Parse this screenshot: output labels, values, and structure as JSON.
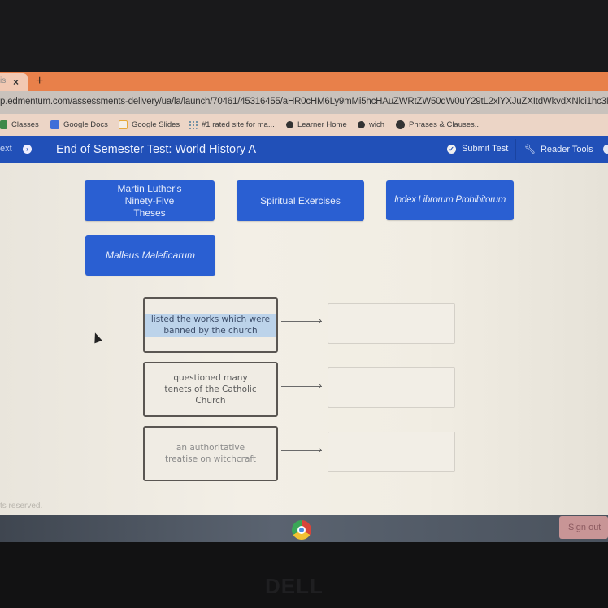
{
  "browser": {
    "tab": {
      "label": "is",
      "close_icon": "×"
    },
    "new_tab_icon": "+",
    "url": "p.edmentum.com/assessments-delivery/ua/la/launch/70461/45316455/aHR0cHM6Ly9mMi5hcHAuZWRtZW50dW0uY29tL2xlYXJuZXItdWkvdXNlci1hc3NpZ",
    "bookmarks": [
      {
        "label": "Classes",
        "icon": "classroom-icon",
        "color": "#3f8a4a"
      },
      {
        "label": "Google Docs",
        "icon": "google-docs-icon",
        "color": "#3e6fd8"
      },
      {
        "label": "Google Slides",
        "icon": "google-slides-icon",
        "color": "#e6a93a"
      },
      {
        "label": "#1 rated site for ma...",
        "icon": "site-icon",
        "color": "#4a7a9a"
      },
      {
        "label": "Learner Home",
        "icon": "edmentum-icon",
        "color": "#333333"
      },
      {
        "label": "wich",
        "icon": "edmentum-icon",
        "color": "#333333"
      },
      {
        "label": "Phrases & Clauses...",
        "icon": "globe-icon",
        "color": "#333333"
      }
    ]
  },
  "appbar": {
    "next_label": "ext",
    "title": "End of Semester Test: World History A",
    "submit_label": "Submit Test",
    "reader_tools_label": "Reader Tools",
    "accent_color": "#2150b8"
  },
  "answer_chips": [
    {
      "label": "Martin Luther's Ninety-Five Theses",
      "italic": false
    },
    {
      "label": "Spiritual Exercises",
      "italic": false
    },
    {
      "label": "Index Librorum Prohibitorum",
      "italic": true
    },
    {
      "label": "Malleus Maleficarum",
      "italic": true
    }
  ],
  "match_rows": [
    {
      "description": "listed the works which were banned by the church",
      "highlighted": true,
      "answer": ""
    },
    {
      "description": "questioned many tenets of the Catholic Church",
      "highlighted": false,
      "answer": ""
    },
    {
      "description": "an authoritative treatise on witchcraft",
      "highlighted": false,
      "answer": ""
    }
  ],
  "footer": {
    "text": "ts reserved."
  },
  "shelf": {
    "sign_out_label": "Sign out"
  },
  "hardware": {
    "brand": "DELL"
  }
}
